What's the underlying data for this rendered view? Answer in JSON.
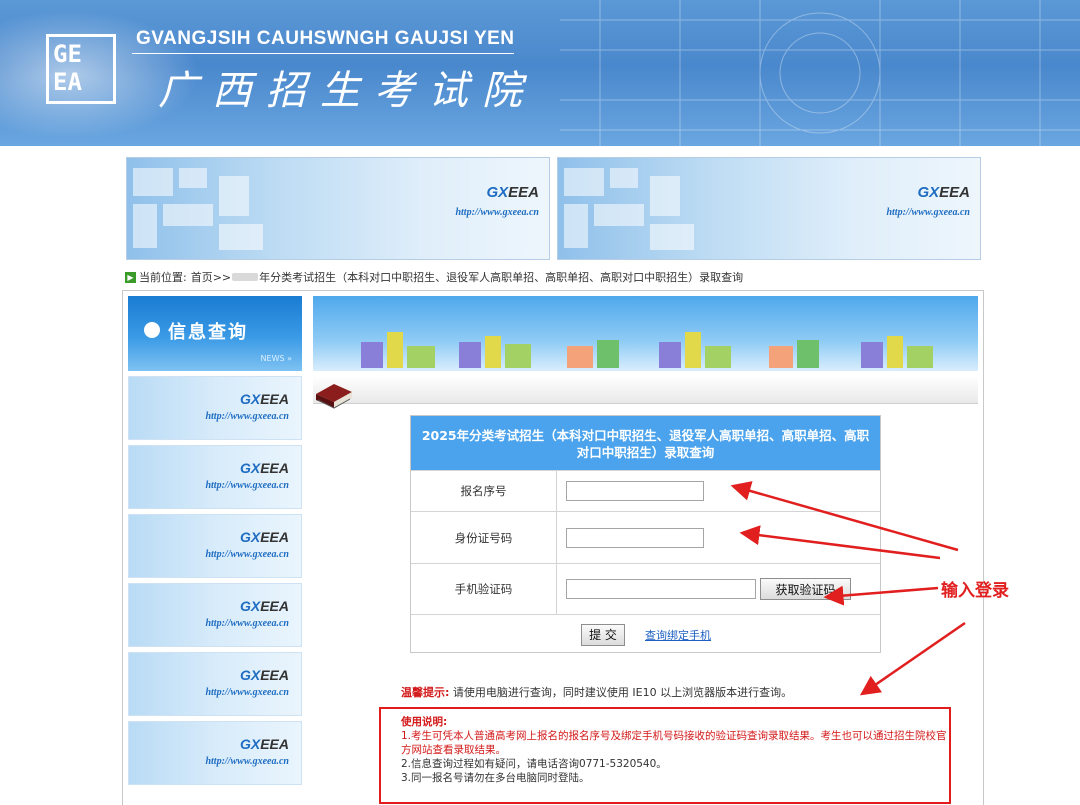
{
  "header": {
    "logo_letters": [
      "GE",
      "EA"
    ],
    "title_en": "GVANGJSIH CAUHSWNGH GAUJSI YEN",
    "title_cn": "广西招生考试院"
  },
  "banners": [
    {
      "brand_prefix": "GX",
      "brand_suffix": "EEA",
      "url": "http://www.gxeea.cn"
    },
    {
      "brand_prefix": "GX",
      "brand_suffix": "EEA",
      "url": "http://www.gxeea.cn"
    }
  ],
  "breadcrumb": {
    "label": "当前位置:",
    "home": "首页>>",
    "current": "年分类考试招生（本科对口中职招生、退役军人高职单招、高职单招、高职对口中职招生）录取查询"
  },
  "sidebar": {
    "title": "信息查询",
    "news": "NEWS »",
    "items": [
      {
        "brand_prefix": "GX",
        "brand_suffix": "EEA",
        "url": "http://www.gxeea.cn"
      },
      {
        "brand_prefix": "GX",
        "brand_suffix": "EEA",
        "url": "http://www.gxeea.cn"
      },
      {
        "brand_prefix": "GX",
        "brand_suffix": "EEA",
        "url": "http://www.gxeea.cn"
      },
      {
        "brand_prefix": "GX",
        "brand_suffix": "EEA",
        "url": "http://www.gxeea.cn"
      },
      {
        "brand_prefix": "GX",
        "brand_suffix": "EEA",
        "url": "http://www.gxeea.cn"
      },
      {
        "brand_prefix": "GX",
        "brand_suffix": "EEA",
        "url": "http://www.gxeea.cn"
      }
    ]
  },
  "form": {
    "title": "2025年分类考试招生（本科对口中职招生、退役军人高职单招、高职单招、高职对口中职招生）录取查询",
    "reg_label": "报名序号",
    "reg_value": "",
    "id_label": "身份证号码",
    "id_value": "",
    "sms_label": "手机验证码",
    "sms_value": "",
    "sms_button": "获取验证码",
    "submit_button": "提 交",
    "bind_link": "查询绑定手机"
  },
  "tip": {
    "label": "温馨提示:",
    "text": "请使用电脑进行查询，同时建议使用 IE10 以上浏览器版本进行查询。"
  },
  "notes": {
    "title": "使用说明:",
    "line1": "1.考生可凭本人普通高考网上报名的报名序号及绑定手机号码接收的验证码查询录取结果。考生也可以通过招生院校官方网站查看录取结果。",
    "line2": "2.信息查询过程如有疑问，请电话咨询0771-5320540。",
    "line3": "3.同一报名号请勿在多台电脑同时登陆。"
  },
  "annotation": {
    "text": "输入登录",
    "color": "#e11f1f"
  },
  "colors": {
    "accent_blue": "#4aa3ec",
    "header_blue": "#4a88cd",
    "warning_red": "#d31a1a",
    "link_blue": "#1d5fc2"
  },
  "icons": [
    "breadcrumb-arrow-icon",
    "info-dot-icon",
    "book-icon"
  ]
}
